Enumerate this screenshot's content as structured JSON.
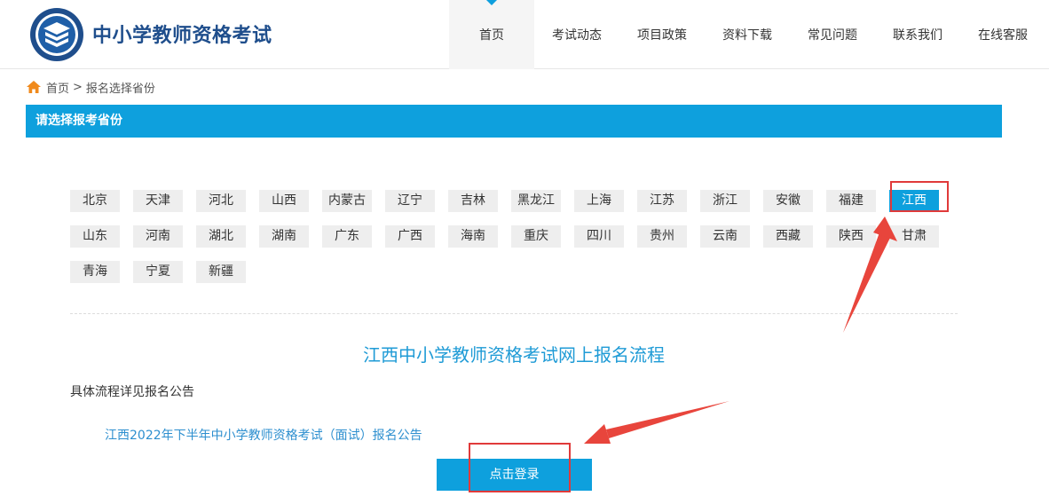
{
  "header": {
    "site_title": "中小学教师资格考试",
    "nav": [
      {
        "label": "首页",
        "active": true
      },
      {
        "label": "考试动态"
      },
      {
        "label": "项目政策"
      },
      {
        "label": "资料下载"
      },
      {
        "label": "常见问题"
      },
      {
        "label": "联系我们"
      },
      {
        "label": "在线客服"
      }
    ]
  },
  "breadcrumb": {
    "home": "首页",
    "separator": ">",
    "current": "报名选择省份"
  },
  "section_title": "请选择报考省份",
  "provinces": [
    "北京",
    "天津",
    "河北",
    "山西",
    "内蒙古",
    "辽宁",
    "吉林",
    "黑龙江",
    "上海",
    "江苏",
    "浙江",
    "安徽",
    "福建",
    "江西",
    "山东",
    "河南",
    "湖北",
    "湖南",
    "广东",
    "广西",
    "海南",
    "重庆",
    "四川",
    "贵州",
    "云南",
    "西藏",
    "陕西",
    "甘肃",
    "青海",
    "宁夏",
    "新疆"
  ],
  "selected_province": "江西",
  "flow": {
    "title": "江西中小学教师资格考试网上报名流程",
    "note": "具体流程详见报名公告",
    "notice_link": "江西2022年下半年中小学教师资格考试（面试）报名公告",
    "login_button": "点击登录"
  },
  "colors": {
    "accent": "#0ea0dd",
    "brand": "#1f4e8c",
    "annotation": "#e03a3a"
  }
}
